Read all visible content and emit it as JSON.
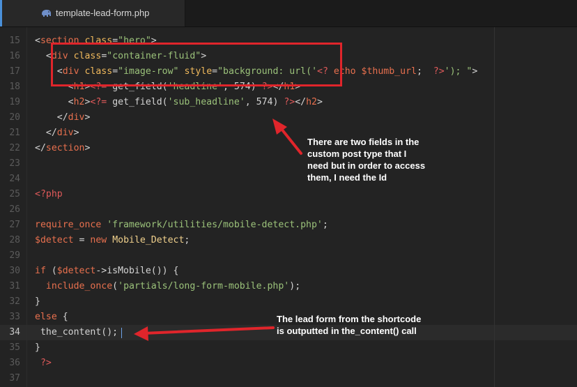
{
  "tab": {
    "filename": "template-lead-form.php",
    "icon": "php-elephant-icon"
  },
  "editor": {
    "current_line": "34",
    "lines": [
      {
        "n": "15",
        "tokens": [
          {
            "t": "<",
            "c": "t-def"
          },
          {
            "t": "section",
            "c": "t-tag"
          },
          {
            "t": " ",
            "c": "t-def"
          },
          {
            "t": "class",
            "c": "t-attr"
          },
          {
            "t": "=",
            "c": "t-def"
          },
          {
            "t": "\"hero\"",
            "c": "t-str"
          },
          {
            "t": ">",
            "c": "t-def"
          }
        ]
      },
      {
        "n": "16",
        "tokens": [
          {
            "t": "  <",
            "c": "t-def"
          },
          {
            "t": "div",
            "c": "t-tag"
          },
          {
            "t": " ",
            "c": "t-def"
          },
          {
            "t": "class",
            "c": "t-attr"
          },
          {
            "t": "=",
            "c": "t-def"
          },
          {
            "t": "\"container-fluid\"",
            "c": "t-str"
          },
          {
            "t": ">",
            "c": "t-def"
          }
        ]
      },
      {
        "n": "17",
        "tokens": [
          {
            "t": "    <",
            "c": "t-def"
          },
          {
            "t": "div",
            "c": "t-tag"
          },
          {
            "t": " ",
            "c": "t-def"
          },
          {
            "t": "class",
            "c": "t-attr"
          },
          {
            "t": "=",
            "c": "t-def"
          },
          {
            "t": "\"image-row\"",
            "c": "t-str"
          },
          {
            "t": " ",
            "c": "t-def"
          },
          {
            "t": "style",
            "c": "t-attr"
          },
          {
            "t": "=",
            "c": "t-def"
          },
          {
            "t": "\"background: url('",
            "c": "t-str"
          },
          {
            "t": "<?",
            "c": "t-php"
          },
          {
            "t": " echo ",
            "c": "t-kw"
          },
          {
            "t": "$thumb_url",
            "c": "t-var"
          },
          {
            "t": ";  ",
            "c": "t-def"
          },
          {
            "t": "?>",
            "c": "t-php"
          },
          {
            "t": "'); \"",
            "c": "t-str"
          },
          {
            "t": ">",
            "c": "t-def"
          }
        ]
      },
      {
        "n": "18",
        "tokens": [
          {
            "t": "      <",
            "c": "t-def"
          },
          {
            "t": "h1",
            "c": "t-tag"
          },
          {
            "t": ">",
            "c": "t-def"
          },
          {
            "t": "<?=",
            "c": "t-php"
          },
          {
            "t": " get_field(",
            "c": "t-fn"
          },
          {
            "t": "'headline'",
            "c": "t-str"
          },
          {
            "t": ", 574) ",
            "c": "t-num"
          },
          {
            "t": "?>",
            "c": "t-php"
          },
          {
            "t": "</",
            "c": "t-def"
          },
          {
            "t": "h1",
            "c": "t-tag"
          },
          {
            "t": ">",
            "c": "t-def"
          }
        ]
      },
      {
        "n": "19",
        "tokens": [
          {
            "t": "      <",
            "c": "t-def"
          },
          {
            "t": "h2",
            "c": "t-tag"
          },
          {
            "t": ">",
            "c": "t-def"
          },
          {
            "t": "<?=",
            "c": "t-php"
          },
          {
            "t": " get_field(",
            "c": "t-fn"
          },
          {
            "t": "'sub_headline'",
            "c": "t-str"
          },
          {
            "t": ", 574) ",
            "c": "t-num"
          },
          {
            "t": "?>",
            "c": "t-php"
          },
          {
            "t": "</",
            "c": "t-def"
          },
          {
            "t": "h2",
            "c": "t-tag"
          },
          {
            "t": ">",
            "c": "t-def"
          }
        ]
      },
      {
        "n": "20",
        "tokens": [
          {
            "t": "    </",
            "c": "t-def"
          },
          {
            "t": "div",
            "c": "t-tag"
          },
          {
            "t": ">",
            "c": "t-def"
          }
        ]
      },
      {
        "n": "21",
        "tokens": [
          {
            "t": "  </",
            "c": "t-def"
          },
          {
            "t": "div",
            "c": "t-tag"
          },
          {
            "t": ">",
            "c": "t-def"
          }
        ]
      },
      {
        "n": "22",
        "tokens": [
          {
            "t": "</",
            "c": "t-def"
          },
          {
            "t": "section",
            "c": "t-tag"
          },
          {
            "t": ">",
            "c": "t-def"
          }
        ]
      },
      {
        "n": "23",
        "tokens": []
      },
      {
        "n": "24",
        "tokens": []
      },
      {
        "n": "25",
        "tokens": [
          {
            "t": "<?php",
            "c": "t-php"
          }
        ]
      },
      {
        "n": "26",
        "tokens": []
      },
      {
        "n": "27",
        "tokens": [
          {
            "t": "require_once",
            "c": "t-kw"
          },
          {
            "t": " ",
            "c": "t-def"
          },
          {
            "t": "'framework/utilities/mobile-detect.php'",
            "c": "t-str"
          },
          {
            "t": ";",
            "c": "t-def"
          }
        ]
      },
      {
        "n": "28",
        "tokens": [
          {
            "t": "$detect",
            "c": "t-var"
          },
          {
            "t": " = ",
            "c": "t-def"
          },
          {
            "t": "new",
            "c": "t-kw"
          },
          {
            "t": " ",
            "c": "t-def"
          },
          {
            "t": "Mobile_Detect",
            "c": "t-class"
          },
          {
            "t": ";",
            "c": "t-def"
          }
        ]
      },
      {
        "n": "29",
        "tokens": []
      },
      {
        "n": "30",
        "tokens": [
          {
            "t": "if",
            "c": "t-kw"
          },
          {
            "t": " (",
            "c": "t-def"
          },
          {
            "t": "$detect",
            "c": "t-var"
          },
          {
            "t": "->isMobile()) {",
            "c": "t-def"
          }
        ]
      },
      {
        "n": "31",
        "tokens": [
          {
            "t": "  ",
            "c": "t-def"
          },
          {
            "t": "include_once",
            "c": "t-kw"
          },
          {
            "t": "(",
            "c": "t-def"
          },
          {
            "t": "'partials/long-form-mobile.php'",
            "c": "t-str"
          },
          {
            "t": ");",
            "c": "t-def"
          }
        ]
      },
      {
        "n": "32",
        "tokens": [
          {
            "t": "}",
            "c": "t-def"
          }
        ]
      },
      {
        "n": "33",
        "tokens": [
          {
            "t": "else",
            "c": "t-kw"
          },
          {
            "t": " {",
            "c": "t-def"
          }
        ]
      },
      {
        "n": "34",
        "tokens": [
          {
            "t": " the_content();",
            "c": "t-def"
          }
        ]
      },
      {
        "n": "35",
        "tokens": [
          {
            "t": "}",
            "c": "t-def"
          }
        ]
      },
      {
        "n": "36",
        "tokens": [
          {
            "t": " ?>",
            "c": "t-php"
          }
        ]
      },
      {
        "n": "37",
        "tokens": []
      }
    ]
  },
  "annotations": {
    "top_note": [
      "There are two fields in the",
      "custom post type that I",
      "need but in order to access",
      "them, I need the Id"
    ],
    "bottom_note": [
      "The lead form from the shortcode",
      "is outputted in the_content() call"
    ]
  },
  "colors": {
    "annotation_red": "#e0252b",
    "background": "#232323",
    "cursor": "#6fa3e8"
  }
}
